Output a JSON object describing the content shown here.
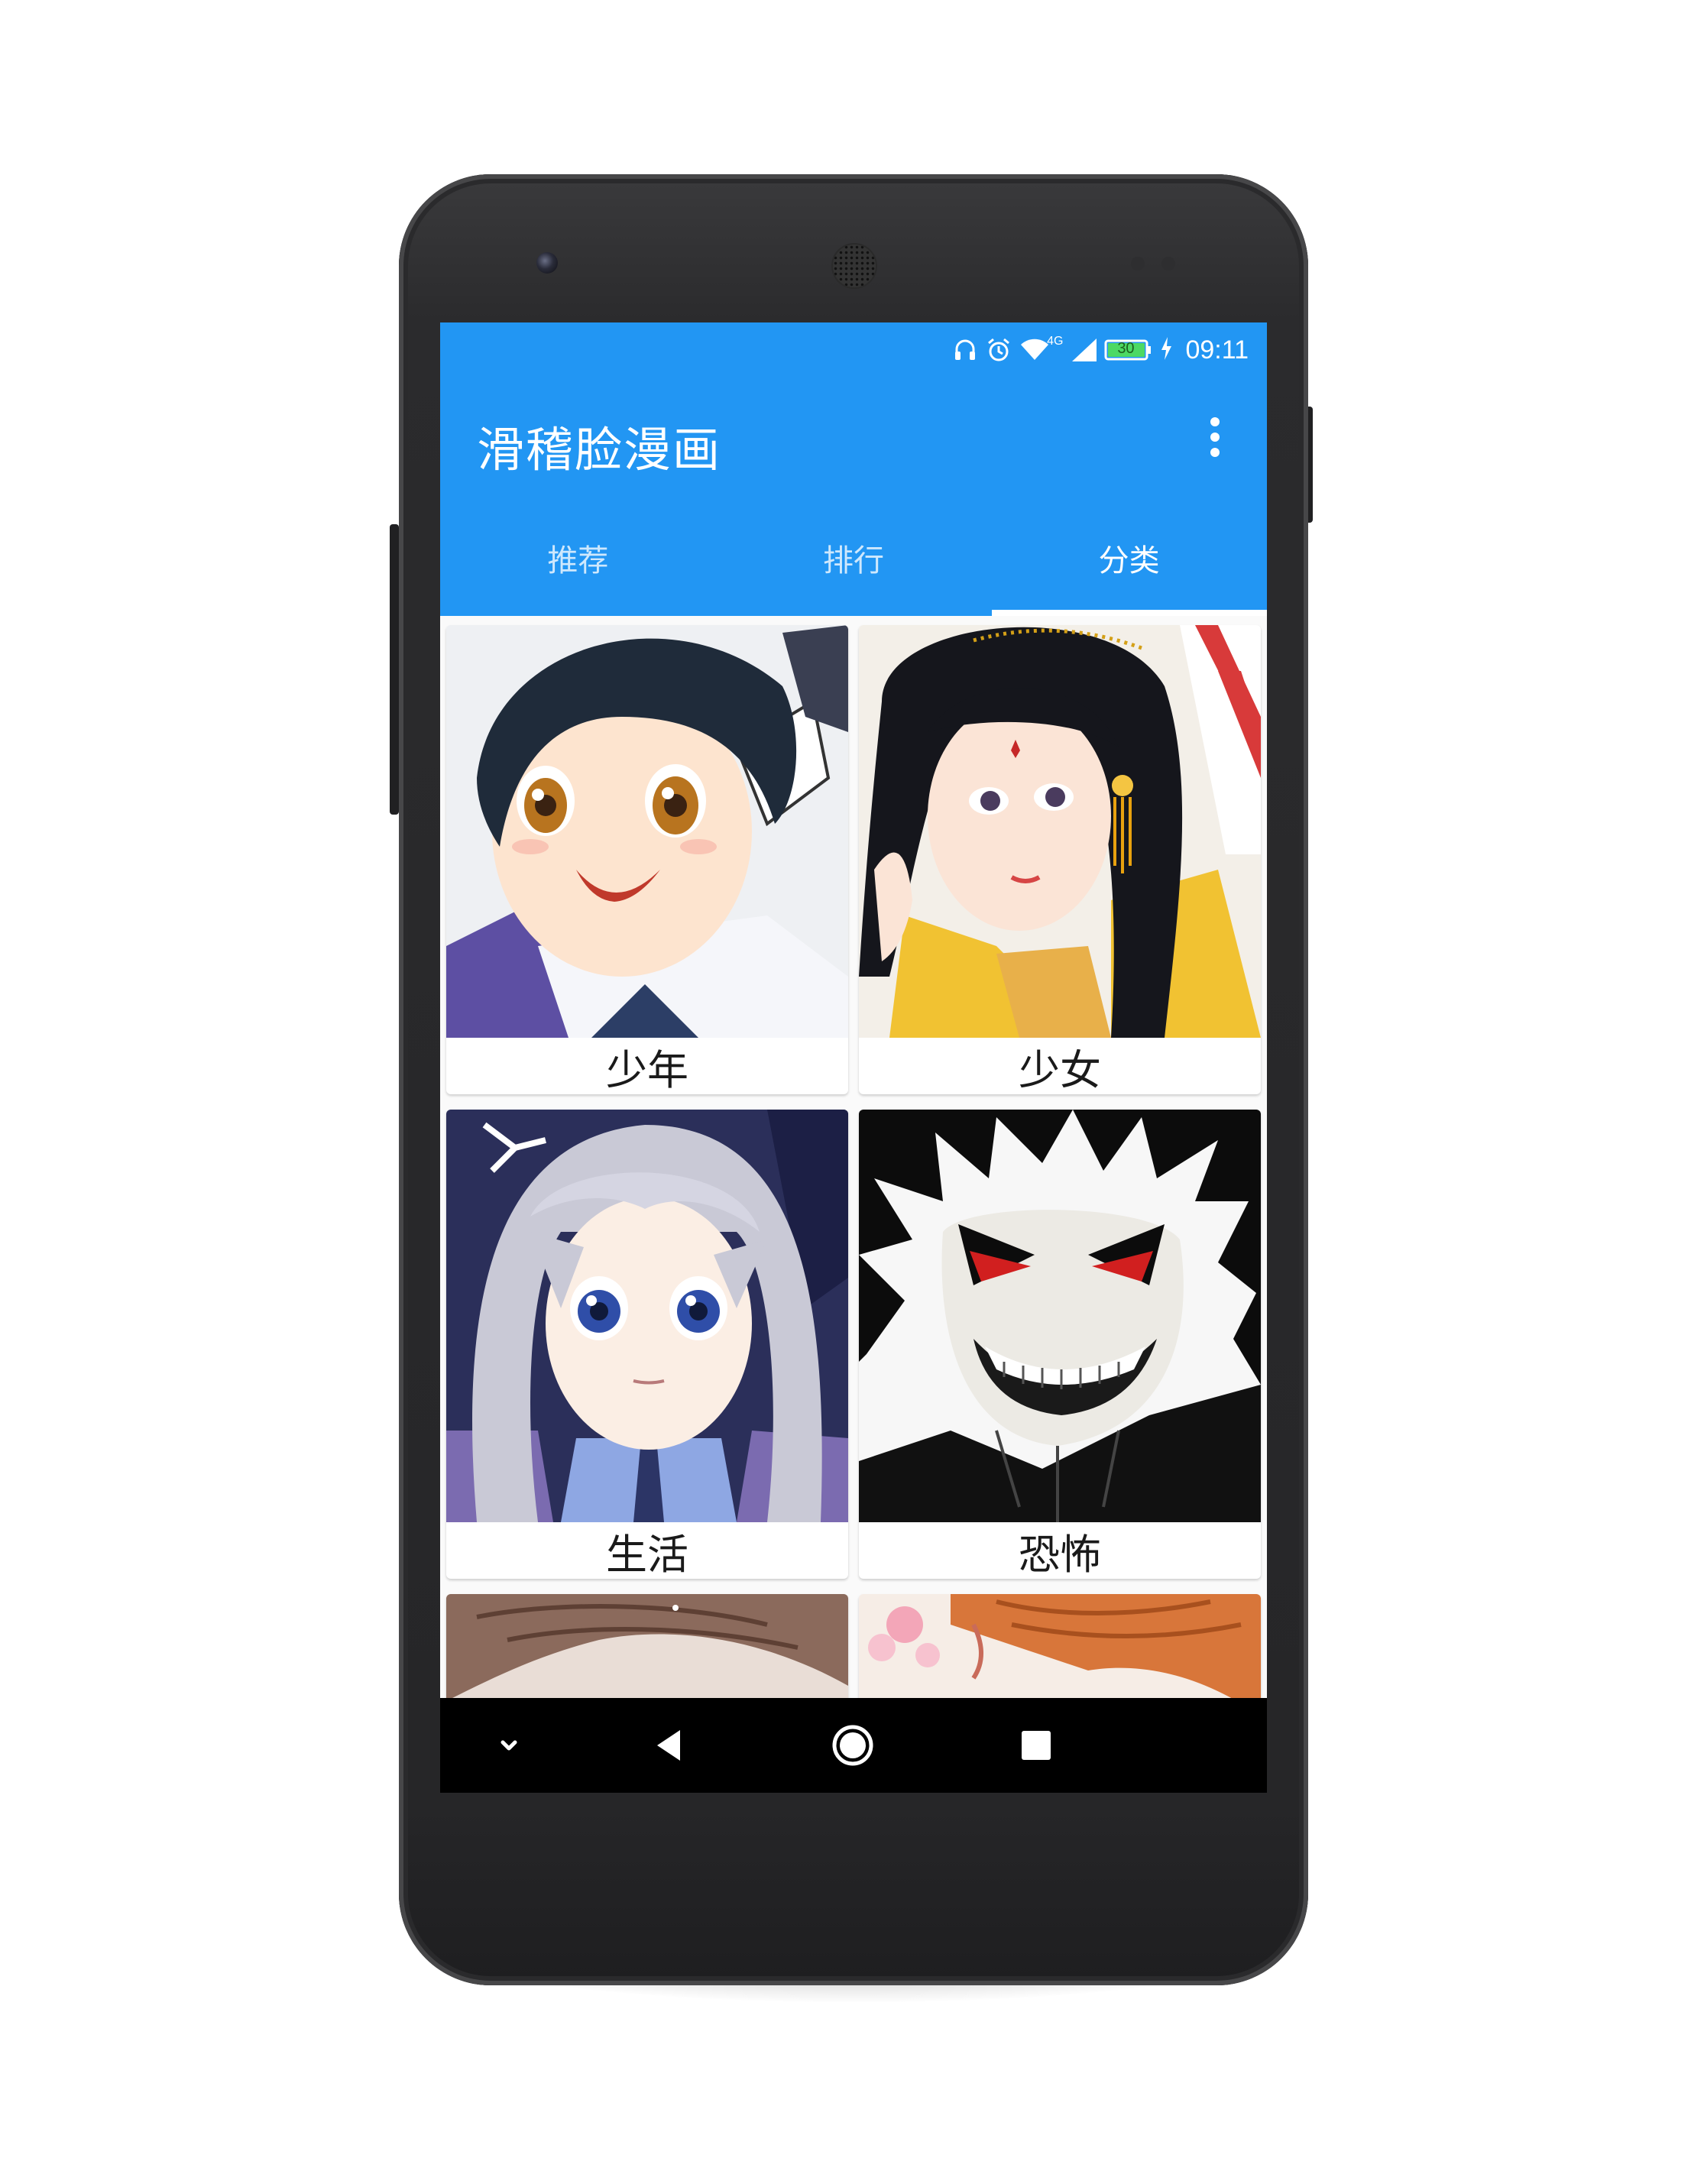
{
  "status_bar": {
    "network": "4G",
    "battery": "30",
    "time": "09:11",
    "icons": [
      "headset-icon",
      "alarm-icon",
      "wifi-icon",
      "signal-icon",
      "battery-icon",
      "charging-icon"
    ]
  },
  "app_bar": {
    "title": "滑稽脸漫画",
    "menu_icon": "overflow-menu-icon",
    "color": "#2296f3"
  },
  "tabs": [
    {
      "label": "推荐",
      "active": false
    },
    {
      "label": "排行",
      "active": false
    },
    {
      "label": "分类",
      "active": true
    }
  ],
  "categories": [
    {
      "label": "少年",
      "image": "anime-boy-portrait"
    },
    {
      "label": "少女",
      "image": "anime-girl-traditional-portrait"
    },
    {
      "label": "生活",
      "image": "anime-girl-silver-hair-portrait"
    },
    {
      "label": "恐怖",
      "image": "horror-grinning-face-portrait"
    },
    {
      "label": "",
      "image": "partial-portrait-brown-hair"
    },
    {
      "label": "",
      "image": "partial-portrait-orange-hair"
    }
  ],
  "nav_bar": {
    "buttons": [
      "collapse-icon",
      "back-icon",
      "home-icon",
      "recents-icon"
    ]
  }
}
